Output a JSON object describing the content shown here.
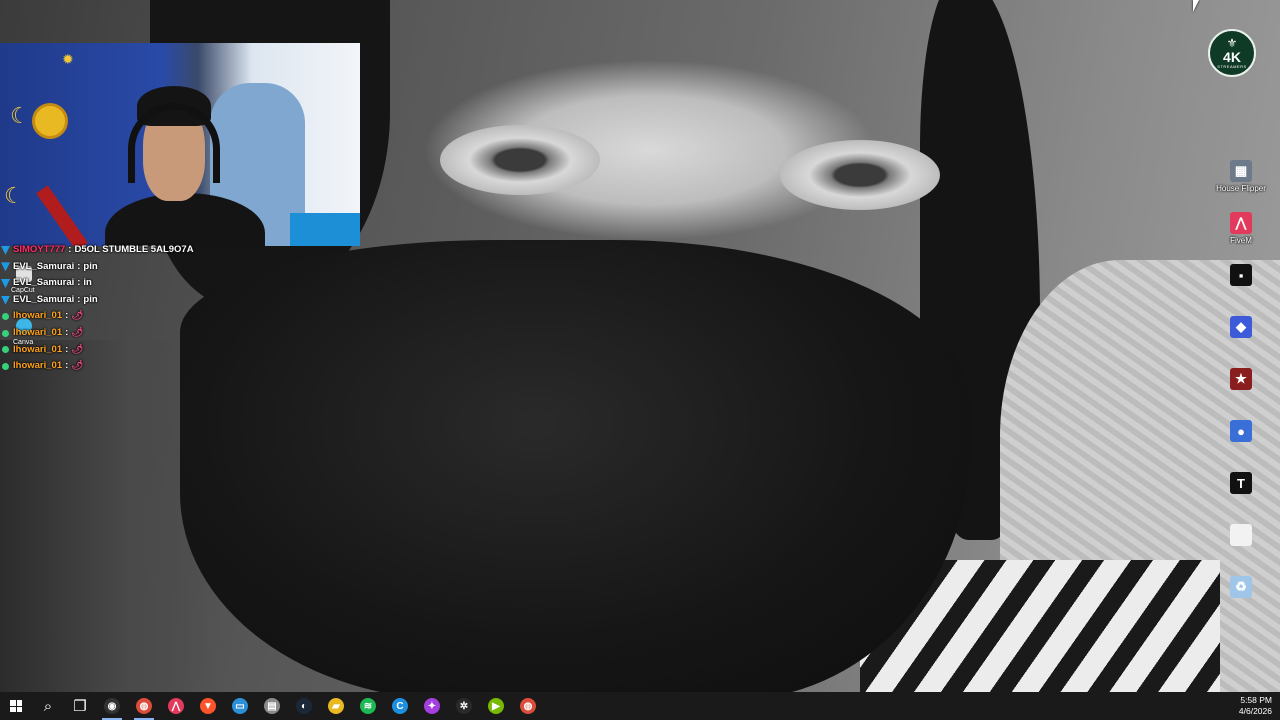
{
  "chat": {
    "messages": [
      {
        "user": "SIMOYT777",
        "sep": ":",
        "text": "D5OL STUMBLE 5AL9O7A",
        "badge": "mod",
        "color": "#ff2d6f"
      },
      {
        "user": "EVL_Samurai",
        "sep": ":",
        "text": "pin",
        "badge": "mod",
        "color": "#ffffff"
      },
      {
        "user": "EVL_Samurai",
        "sep": ":",
        "text": "in",
        "badge": "mod",
        "color": "#ffffff"
      },
      {
        "user": "EVL_Samurai",
        "sep": ":",
        "text": "pin",
        "badge": "mod",
        "color": "#ffffff"
      },
      {
        "user": "lhowari_01",
        "sep": ":",
        "text": "🌶",
        "badge": "dot",
        "color": "#ffa21a"
      },
      {
        "user": "lhowari_01",
        "sep": ":",
        "text": "🌶",
        "badge": "dot",
        "color": "#ffa21a"
      },
      {
        "user": "lhowari_01",
        "sep": ":",
        "text": "🌶",
        "badge": "dot",
        "color": "#ffa21a"
      },
      {
        "user": "lhowari_01",
        "sep": ":",
        "text": "🌶",
        "badge": "dot",
        "color": "#ffa21a"
      }
    ]
  },
  "left_desktop": {
    "capcut_label": "CapCut",
    "canva_label": "Canva"
  },
  "brand_logo": {
    "text": "4K",
    "sub": "STREAMERS",
    "color": "#0f3a26"
  },
  "desktop_icons": [
    {
      "name": "house-flipper",
      "label": "House Flipper",
      "glyph": "▦",
      "bg": "#6c7a8a"
    },
    {
      "name": "fivem",
      "label": "FiveM",
      "glyph": "⋀",
      "bg": "#e23a5c"
    },
    {
      "name": "app-black",
      "label": "",
      "glyph": "▪",
      "bg": "#111111"
    },
    {
      "name": "stumble-guys",
      "label": "",
      "glyph": "◆",
      "bg": "#3d5bd8"
    },
    {
      "name": "red-dead",
      "label": "",
      "glyph": "★",
      "bg": "#8a1d1d"
    },
    {
      "name": "location-app",
      "label": "",
      "glyph": "●",
      "bg": "#3a6fd8"
    },
    {
      "name": "tradingview",
      "label": "",
      "glyph": "T",
      "bg": "#111111"
    },
    {
      "name": "file",
      "label": "",
      "glyph": "",
      "bg": "#f2f2f2"
    },
    {
      "name": "recycle-bin",
      "label": "",
      "glyph": "♻",
      "bg": "#9fc6e8"
    }
  ],
  "taskbar": {
    "items": [
      {
        "name": "start",
        "glyph": ""
      },
      {
        "name": "search",
        "glyph": "⌕"
      },
      {
        "name": "task-view",
        "glyph": "❐"
      },
      {
        "name": "obs",
        "glyph": "◉",
        "bg": "#333333",
        "active": true
      },
      {
        "name": "chrome",
        "glyph": "◍",
        "bg": "#dd4b39",
        "active": true
      },
      {
        "name": "fivem",
        "glyph": "⋀",
        "bg": "#e23a5c"
      },
      {
        "name": "brave",
        "glyph": "▼",
        "bg": "#fb542b"
      },
      {
        "name": "app-blue",
        "glyph": "▭",
        "bg": "#2d8fd5"
      },
      {
        "name": "app-gray",
        "glyph": "▤",
        "bg": "#8a8a8a"
      },
      {
        "name": "steam",
        "glyph": "◐",
        "bg": "#1b2838"
      },
      {
        "name": "file-explorer",
        "glyph": "▰",
        "bg": "#e8b923"
      },
      {
        "name": "spotify",
        "glyph": "≋",
        "bg": "#1db954"
      },
      {
        "name": "cursor-app",
        "glyph": "C",
        "bg": "#1e8fe0"
      },
      {
        "name": "messenger",
        "glyph": "✦",
        "bg": "#a33ee0"
      },
      {
        "name": "steelseries",
        "glyph": "✲",
        "bg": "#2a2a2a"
      },
      {
        "name": "nvidia",
        "glyph": "▶",
        "bg": "#76b900"
      },
      {
        "name": "chrome-2",
        "glyph": "◍",
        "bg": "#dd4b39"
      }
    ],
    "time": "5:58 PM",
    "date": "4/6/2026"
  }
}
